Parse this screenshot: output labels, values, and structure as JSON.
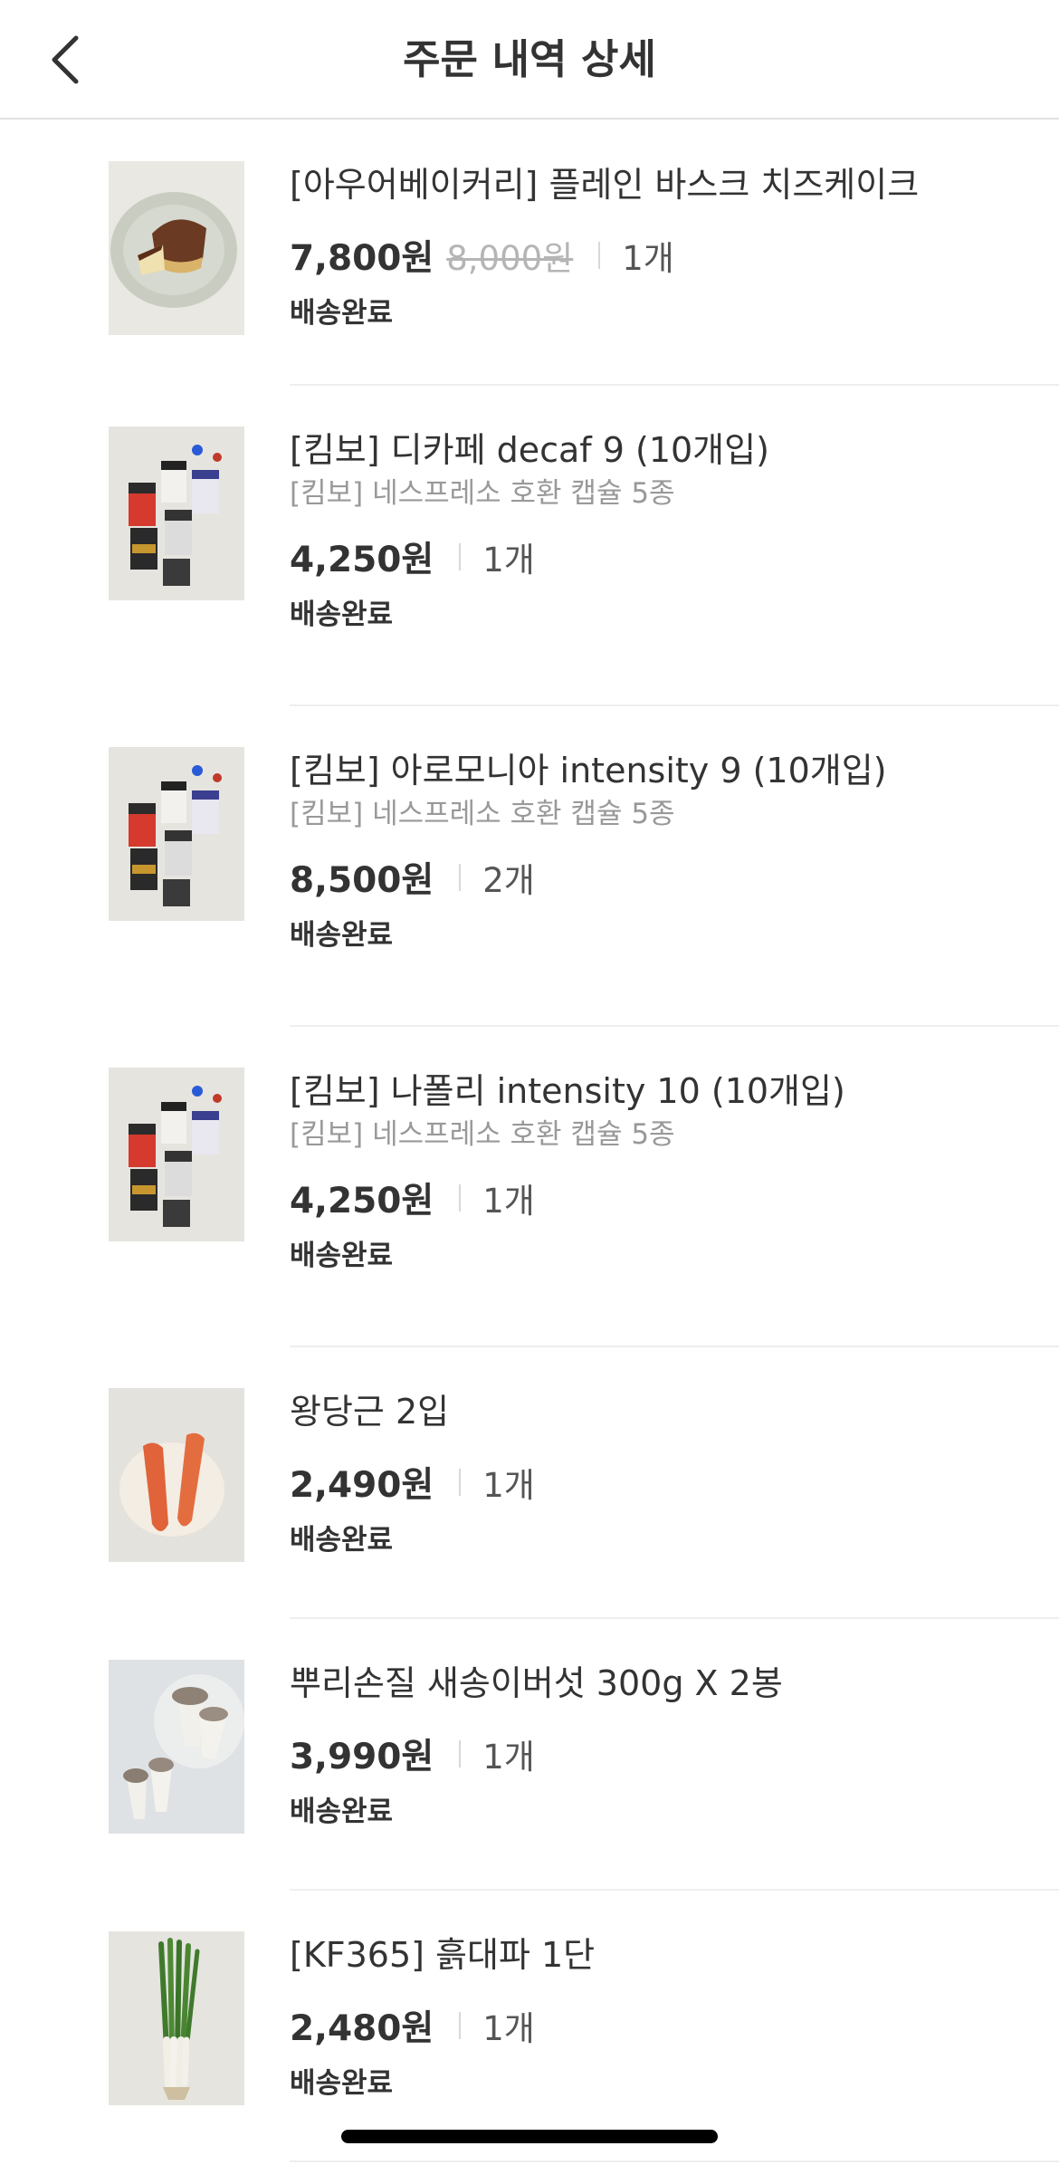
{
  "header": {
    "title": "주문 내역 상세"
  },
  "items": [
    {
      "name": "[아우어베이커리] 플레인 바스크 치즈케이크",
      "sub": "",
      "price": "7,800원",
      "original_price": "8,000원",
      "qty": "1개",
      "status": "배송완료",
      "image": "cheesecake-image"
    },
    {
      "name": "[킴보] 디카페 decaf 9 (10개입)",
      "sub": "[킴보] 네스프레소 호환 캡슐 5종",
      "price": "4,250원",
      "original_price": "",
      "qty": "1개",
      "status": "배송완료",
      "image": "coffee-capsule-image"
    },
    {
      "name": "[킴보] 아로모니아 intensity 9 (10개입)",
      "sub": "[킴보] 네스프레소 호환 캡슐 5종",
      "price": "8,500원",
      "original_price": "",
      "qty": "2개",
      "status": "배송완료",
      "image": "coffee-capsule-image"
    },
    {
      "name": "[킴보] 나폴리 intensity 10 (10개입)",
      "sub": "[킴보] 네스프레소 호환 캡슐 5종",
      "price": "4,250원",
      "original_price": "",
      "qty": "1개",
      "status": "배송완료",
      "image": "coffee-capsule-image"
    },
    {
      "name": "왕당근 2입",
      "sub": "",
      "price": "2,490원",
      "original_price": "",
      "qty": "1개",
      "status": "배송완료",
      "image": "carrot-image"
    },
    {
      "name": "뿌리손질 새송이버섯 300g X 2봉",
      "sub": "",
      "price": "3,990원",
      "original_price": "",
      "qty": "1개",
      "status": "배송완료",
      "image": "mushroom-image"
    },
    {
      "name": "[KF365] 흙대파 1단",
      "sub": "",
      "price": "2,480원",
      "original_price": "",
      "qty": "1개",
      "status": "배송완료",
      "image": "green-onion-image"
    }
  ],
  "colors": {
    "text": "#333333",
    "sub_text": "#999999",
    "strike": "#b5b5b5",
    "divider": "#eeeeee"
  },
  "icons": {
    "back": "chevron-left-icon"
  }
}
